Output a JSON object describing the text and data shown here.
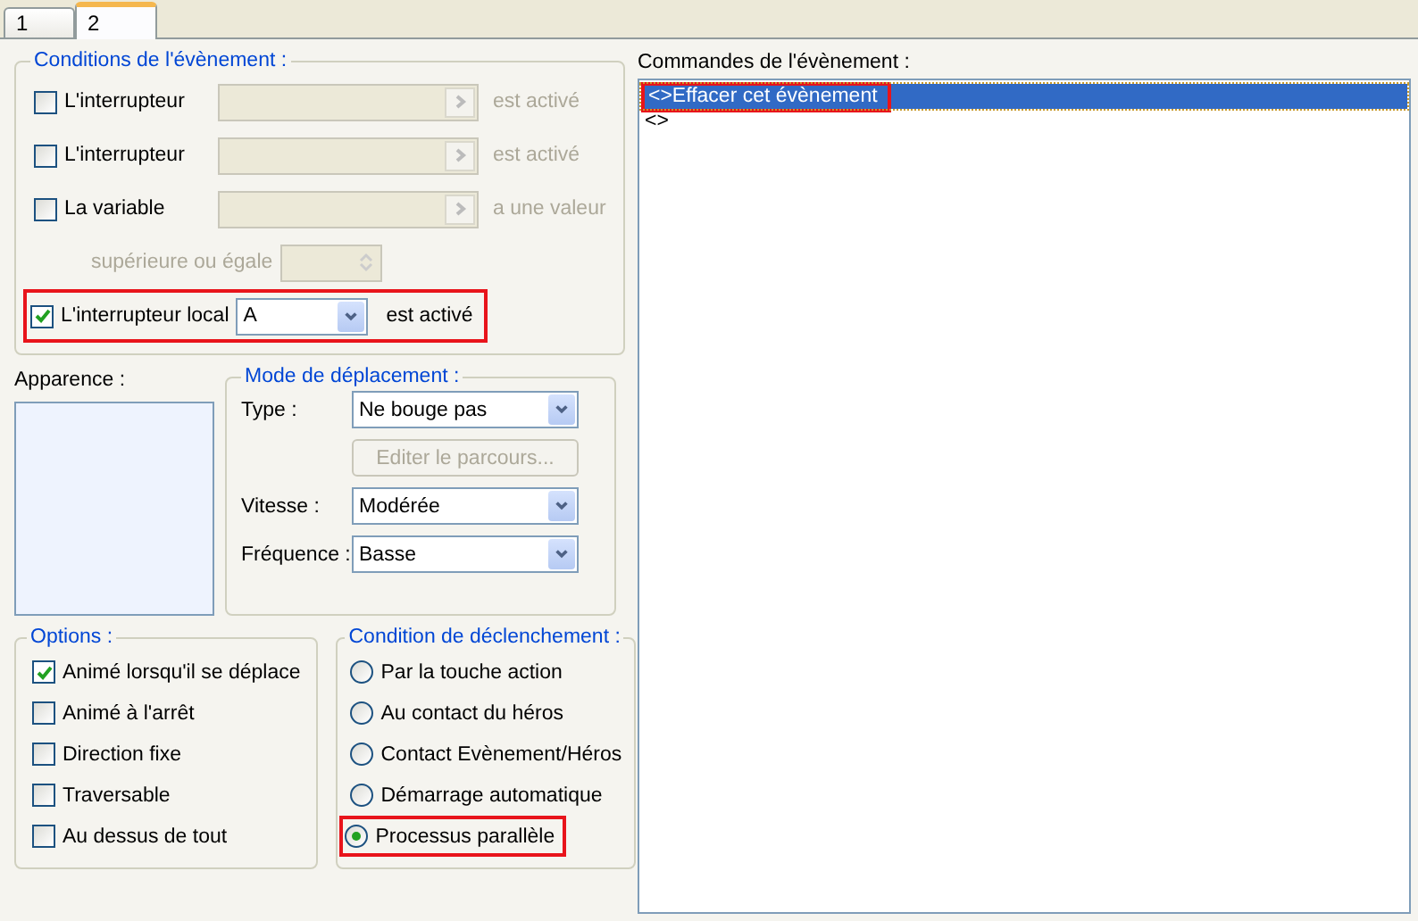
{
  "tabs": [
    {
      "label": "1",
      "selected": false
    },
    {
      "label": "2",
      "selected": true
    }
  ],
  "conditions": {
    "title": "Conditions de l'évènement :",
    "rows": [
      {
        "kind": "switch",
        "label": "L'interrupteur",
        "checked": false,
        "disabled": true,
        "suffix": "est activé",
        "highlighted": false
      },
      {
        "kind": "switch",
        "label": "L'interrupteur",
        "checked": false,
        "disabled": true,
        "suffix": "est activé",
        "highlighted": false
      },
      {
        "kind": "switch",
        "label": "La variable",
        "checked": false,
        "disabled": true,
        "suffix": "a une valeur",
        "highlighted": false
      },
      {
        "kind": "compare",
        "label": "supérieure ou égale",
        "disabled": true,
        "highlighted": false
      },
      {
        "kind": "select",
        "label": "L'interrupteur local",
        "checked": true,
        "disabled": false,
        "value": "A",
        "suffix": "est activé",
        "highlighted": true
      }
    ]
  },
  "appearance": {
    "label": "Apparence :"
  },
  "movement": {
    "title": "Mode de déplacement :",
    "type_label": "Type :",
    "type_value": "Ne bouge pas",
    "edit_button": {
      "label": "Editer le parcours...",
      "disabled": true
    },
    "speed_label": "Vitesse :",
    "speed_value": "Modérée",
    "frequency_label": "Fréquence :",
    "frequency_value": "Basse"
  },
  "options": {
    "title": "Options :",
    "items": [
      {
        "label": "Animé lorsqu'il se déplace",
        "checked": true
      },
      {
        "label": "Animé à l'arrêt",
        "checked": false
      },
      {
        "label": "Direction fixe",
        "checked": false
      },
      {
        "label": "Traversable",
        "checked": false
      },
      {
        "label": "Au dessus de tout",
        "checked": false
      }
    ]
  },
  "trigger": {
    "title": "Condition de déclenchement :",
    "items": [
      {
        "label": "Par la touche action",
        "selected": false,
        "highlighted": false
      },
      {
        "label": "Au contact du héros",
        "selected": false,
        "highlighted": false
      },
      {
        "label": "Contact Evènement/Héros",
        "selected": false,
        "highlighted": false
      },
      {
        "label": "Démarrage automatique",
        "selected": false,
        "highlighted": false
      },
      {
        "label": "Processus parallèle",
        "selected": true,
        "highlighted": true
      }
    ]
  },
  "commands": {
    "label": "Commandes de l'évènement :",
    "items": [
      {
        "text": "<>Effacer cet évènement",
        "selected": true,
        "highlighted": true
      },
      {
        "text": "<>",
        "selected": false,
        "highlighted": false
      }
    ]
  }
}
